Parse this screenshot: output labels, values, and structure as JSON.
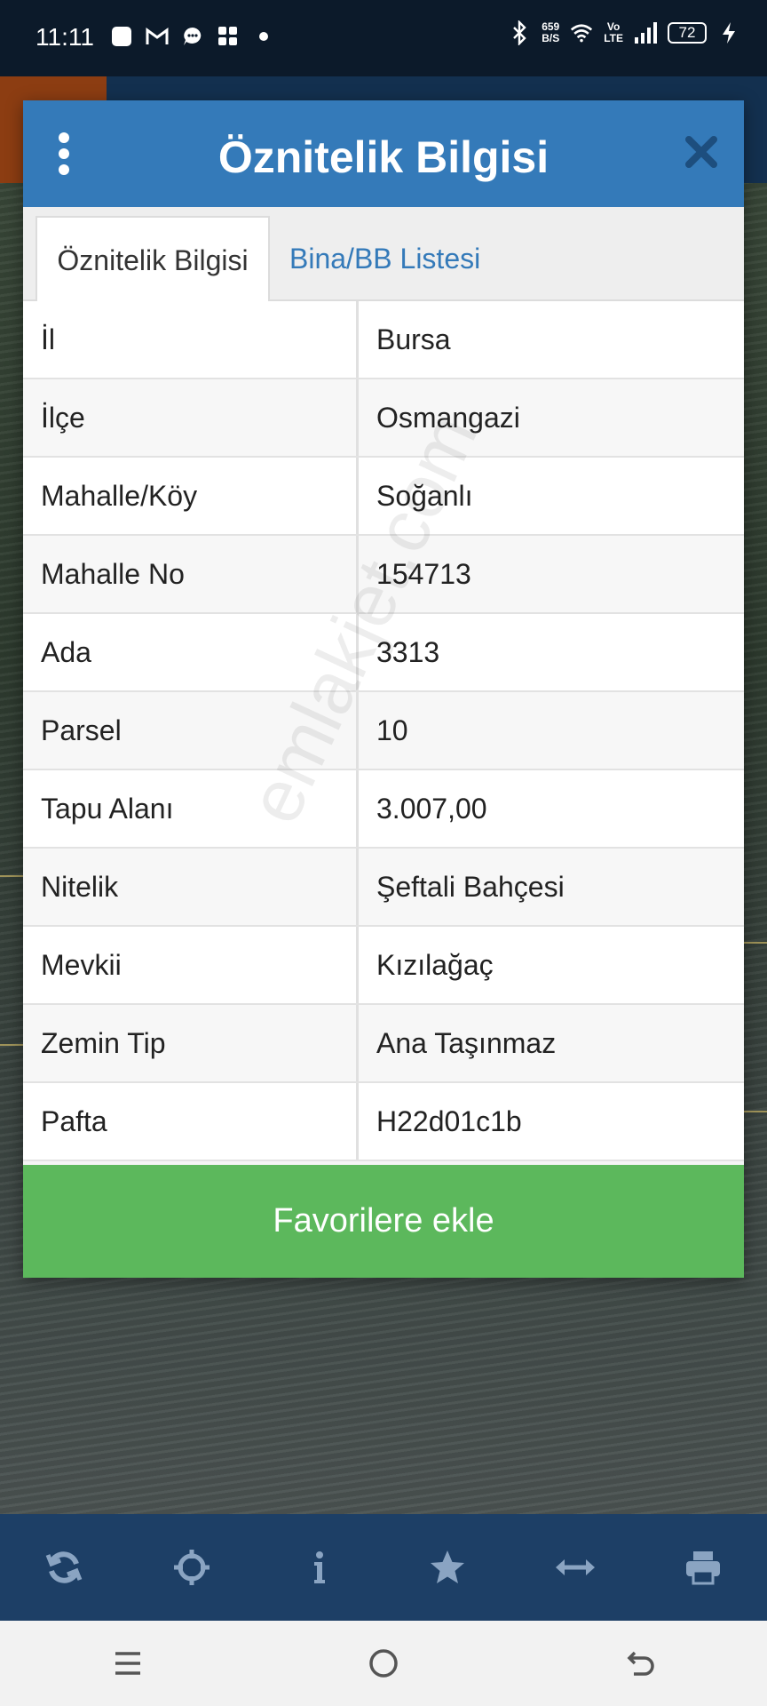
{
  "status_bar": {
    "time": "11:11",
    "net_speed_value": "659",
    "net_speed_unit": "B/S",
    "volte_top": "Vo",
    "volte_bottom": "LTE",
    "battery": "72"
  },
  "dialog": {
    "title": "Öznitelik Bilgisi",
    "tabs": [
      {
        "label": "Öznitelik Bilgisi",
        "active": true
      },
      {
        "label": "Bina/BB Listesi",
        "active": false
      }
    ],
    "rows": [
      {
        "key": "İl",
        "value": "Bursa"
      },
      {
        "key": "İlçe",
        "value": "Osmangazi"
      },
      {
        "key": "Mahalle/Köy",
        "value": "Soğanlı"
      },
      {
        "key": "Mahalle No",
        "value": "154713"
      },
      {
        "key": "Ada",
        "value": "3313"
      },
      {
        "key": "Parsel",
        "value": "10"
      },
      {
        "key": "Tapu Alanı",
        "value": "3.007,00"
      },
      {
        "key": "Nitelik",
        "value": "Şeftali Bahçesi"
      },
      {
        "key": "Mevkii",
        "value": "Kızılağaç"
      },
      {
        "key": "Zemin Tip",
        "value": "Ana Taşınmaz"
      },
      {
        "key": "Pafta",
        "value": "H22d01c1b"
      }
    ],
    "favorite_button": "Favorilere ekle"
  },
  "watermark": "emlakjet.com",
  "toolbar": {
    "icons": [
      "refresh-icon",
      "crosshair-icon",
      "info-icon",
      "star-icon",
      "measure-icon",
      "print-icon"
    ]
  },
  "navbar": {
    "icons": [
      "menu-icon",
      "home-icon",
      "back-icon"
    ]
  },
  "colors": {
    "header": "#347ab9",
    "favorite": "#5cb85c",
    "toolbar": "#1d3f66"
  }
}
